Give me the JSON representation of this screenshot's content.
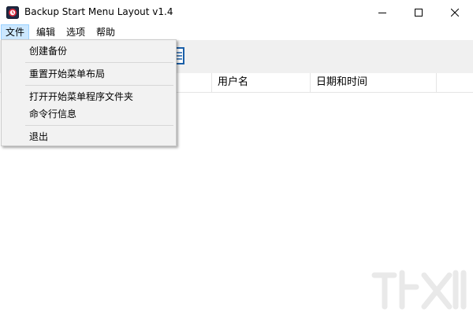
{
  "window": {
    "title": "Backup Start Menu Layout v1.4",
    "app_icon": "app-icon"
  },
  "titlebar_buttons": {
    "minimize_icon": "minimize-icon",
    "maximize_icon": "maximize-icon",
    "close_icon": "close-icon"
  },
  "menubar": {
    "items": [
      {
        "label": "文件",
        "active": true
      },
      {
        "label": "编辑"
      },
      {
        "label": "选项"
      },
      {
        "label": "帮助"
      }
    ]
  },
  "list": {
    "columns": [
      {
        "label": "用户名"
      },
      {
        "label": "日期和时间"
      }
    ]
  },
  "file_menu": {
    "items": [
      {
        "label": "创建备份"
      },
      {
        "label": "重置开始菜单布局"
      },
      {
        "label": "打开开始菜单程序文件夹"
      },
      {
        "label": "命令行信息"
      },
      {
        "label": "退出"
      }
    ]
  },
  "colors": {
    "menu_highlight": "#cce8ff",
    "menu_highlight_border": "#99d1ff",
    "dropdown_bg": "#f2f2f2",
    "toolbar_bg": "#f0f0f0",
    "icon_accent": "#1a5fa8"
  }
}
